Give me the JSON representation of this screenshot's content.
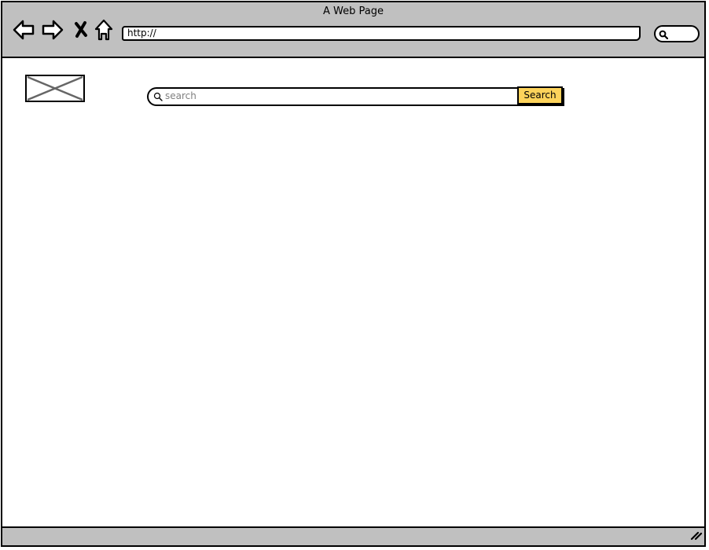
{
  "window": {
    "title": "A Web Page"
  },
  "toolbar": {
    "back_icon": "back-arrow-icon",
    "forward_icon": "forward-arrow-icon",
    "stop_icon": "close-x-icon",
    "home_icon": "home-icon",
    "address_value": "http://",
    "search_icon": "search-icon"
  },
  "page": {
    "logo_icon": "image-placeholder-icon",
    "search": {
      "placeholder": "search",
      "button_label": "Search"
    }
  },
  "colors": {
    "chrome": "#c0c0c0",
    "button_accent": "#fdd35b",
    "placeholder_text": "#808080"
  }
}
